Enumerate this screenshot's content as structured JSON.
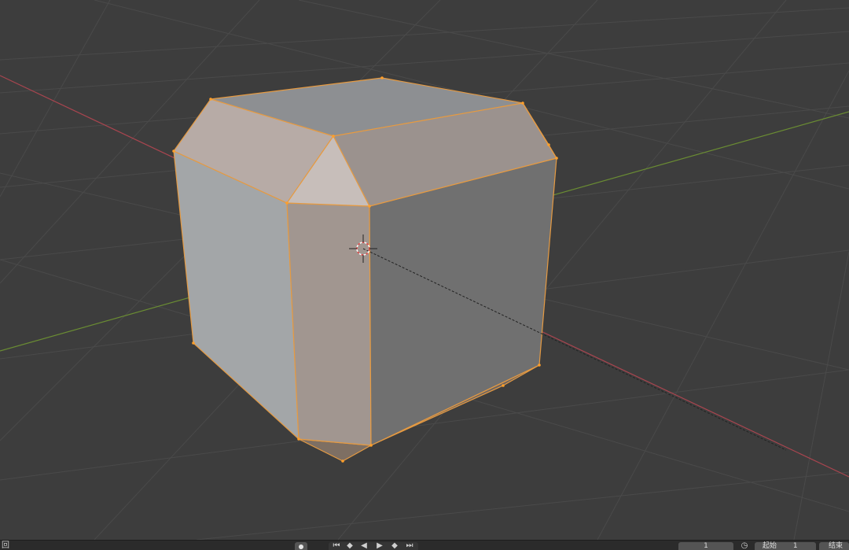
{
  "viewport": {
    "name": "3D Viewport",
    "colors": {
      "background": "#3d3d3d",
      "grid": "#4a4a4a",
      "x_axis": "#a8454f",
      "y_axis": "#6a8c33",
      "selection_edge": "#f0a040",
      "vertex": "#ff9f2a"
    },
    "object": {
      "name": "chamfered-cube",
      "mode": "edit",
      "selected": true
    },
    "cursor_icon": "3d-cursor-icon"
  },
  "timeline": {
    "playback_label": "回",
    "record_icon": "record-icon",
    "transport_icons": [
      "jump-start-icon",
      "prev-keyframe-icon",
      "play-reverse-icon",
      "play-icon",
      "next-keyframe-icon",
      "jump-end-icon"
    ],
    "current_frame": "1",
    "clock_icon": "clock-icon",
    "start_label": "起始",
    "start_value": "1",
    "end_label": "结束"
  }
}
